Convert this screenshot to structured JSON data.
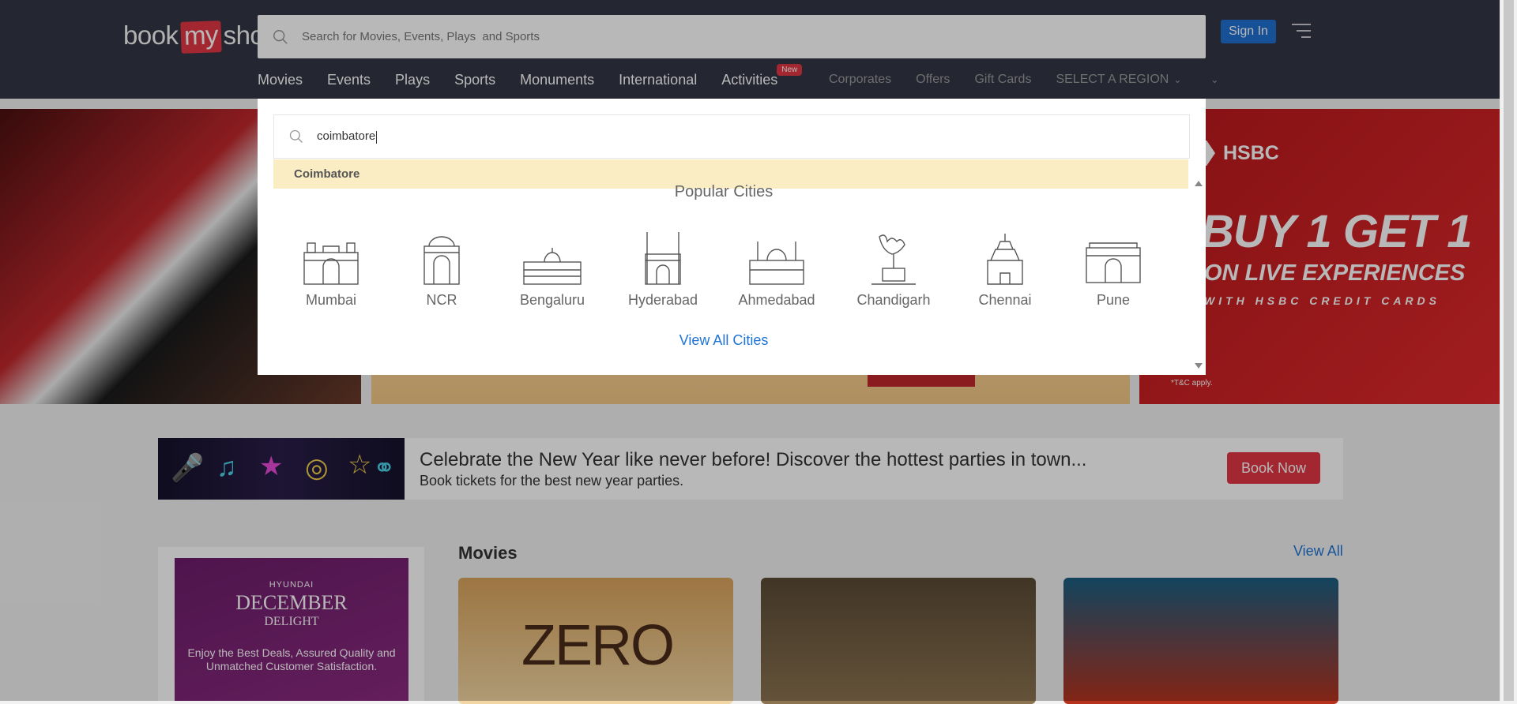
{
  "header": {
    "logo": {
      "part1": "book",
      "part2": "my",
      "part3": "show"
    },
    "search_placeholder": "Search for Movies, Events, Plays  and Sports",
    "signin_label": "Sign In",
    "nav_items": [
      {
        "label": "Movies"
      },
      {
        "label": "Events"
      },
      {
        "label": "Plays"
      },
      {
        "label": "Sports"
      },
      {
        "label": "Monuments"
      },
      {
        "label": "International"
      },
      {
        "label": "Activities",
        "badge": "New"
      }
    ],
    "secondary_nav": [
      {
        "label": "Corporates"
      },
      {
        "label": "Offers"
      },
      {
        "label": "Gift Cards"
      },
      {
        "label": "SELECT A REGION"
      }
    ]
  },
  "banner_right": {
    "brand": "HSBC",
    "line1": "BUY 1 GET 1",
    "line2": "ON LIVE EXPERIENCES",
    "line3": "WITH HSBC CREDIT CARDS",
    "tnc": "*T&C apply."
  },
  "city_popup": {
    "search_value": "coimbatore",
    "suggestion": "Coimbatore",
    "title": "Popular Cities",
    "cities": [
      {
        "name": "Mumbai",
        "icon": "mumbai-icon"
      },
      {
        "name": "NCR",
        "icon": "ncr-icon"
      },
      {
        "name": "Bengaluru",
        "icon": "bengaluru-icon"
      },
      {
        "name": "Hyderabad",
        "icon": "hyderabad-icon"
      },
      {
        "name": "Ahmedabad",
        "icon": "ahmedabad-icon"
      },
      {
        "name": "Chandigarh",
        "icon": "chandigarh-icon"
      },
      {
        "name": "Chennai",
        "icon": "chennai-icon"
      },
      {
        "name": "Pune",
        "icon": "pune-icon"
      }
    ],
    "view_all": "View All Cities"
  },
  "promo": {
    "headline": "Celebrate the New Year like never before! Discover the hottest parties in town...",
    "subline": "Book tickets for the best new year parties.",
    "button": "Book Now"
  },
  "side_ad": {
    "brand": "HYUNDAI",
    "title1": "DECEMBER",
    "title2": "DELIGHT",
    "text": "Enjoy the Best Deals, Assured Quality and Unmatched Customer Satisfaction."
  },
  "movies": {
    "title": "Movies",
    "view_all": "View All",
    "posters": [
      {
        "title": "ZERO"
      },
      {
        "title": ""
      },
      {
        "title": ""
      }
    ]
  },
  "colors": {
    "header_bg": "#333545",
    "brand_red": "#e23744",
    "signin_blue": "#1f6fd2",
    "link_blue": "#1f74d6",
    "suggest_bg": "#faedc3"
  }
}
